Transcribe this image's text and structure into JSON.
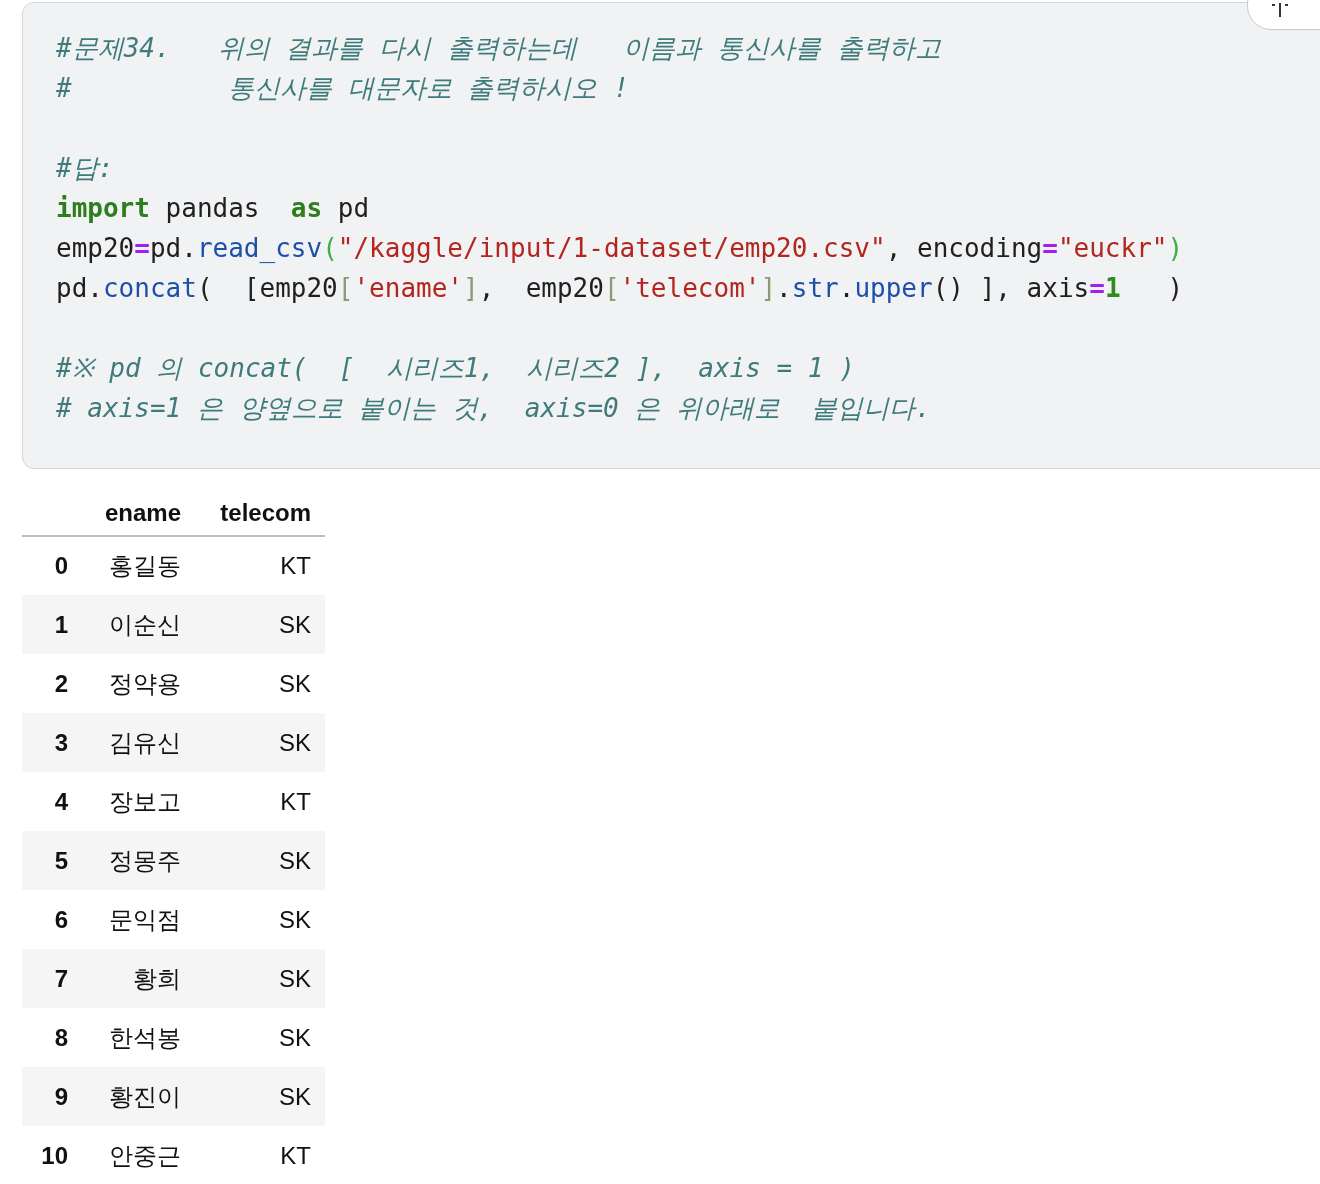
{
  "code_cell": {
    "lines": [
      {
        "kind": "code",
        "tokens": [
          {
            "kind": "comment",
            "text": "#문제34.   위의 결과를 다시 출력하는데   이름과 통신사를 출력하고"
          }
        ]
      },
      {
        "kind": "code",
        "tokens": [
          {
            "kind": "comment",
            "text": "#          통신사를 대문자로 출력하시오 !"
          }
        ]
      },
      {
        "kind": "blank"
      },
      {
        "kind": "code",
        "tokens": [
          {
            "kind": "comment",
            "text": "#답:"
          }
        ]
      },
      {
        "kind": "code",
        "tokens": [
          {
            "kind": "keyword",
            "text": "import"
          },
          {
            "kind": "name",
            "text": " pandas  "
          },
          {
            "kind": "keyword",
            "text": "as"
          },
          {
            "kind": "name",
            "text": " pd"
          }
        ]
      },
      {
        "kind": "code",
        "tokens": [
          {
            "kind": "name",
            "text": "emp20"
          },
          {
            "kind": "operator",
            "text": "="
          },
          {
            "kind": "name",
            "text": "pd."
          },
          {
            "kind": "call",
            "text": "read_csv"
          },
          {
            "kind": "paren",
            "text": "("
          },
          {
            "kind": "string",
            "text": "\"/kaggle/input/1-dataset/emp20.csv\""
          },
          {
            "kind": "name",
            "text": ", encoding"
          },
          {
            "kind": "operator",
            "text": "="
          },
          {
            "kind": "string",
            "text": "\"euckr\""
          },
          {
            "kind": "paren",
            "text": ")"
          }
        ]
      },
      {
        "kind": "code",
        "tokens": [
          {
            "kind": "name",
            "text": "pd."
          },
          {
            "kind": "call",
            "text": "concat"
          },
          {
            "kind": "name",
            "text": "(  [emp20"
          },
          {
            "kind": "bracket",
            "text": "["
          },
          {
            "kind": "string",
            "text": "'ename'"
          },
          {
            "kind": "bracket",
            "text": "]"
          },
          {
            "kind": "name",
            "text": ",  emp20"
          },
          {
            "kind": "bracket",
            "text": "["
          },
          {
            "kind": "string",
            "text": "'telecom'"
          },
          {
            "kind": "bracket",
            "text": "]"
          },
          {
            "kind": "name",
            "text": "."
          },
          {
            "kind": "call",
            "text": "str"
          },
          {
            "kind": "name",
            "text": "."
          },
          {
            "kind": "call",
            "text": "upper"
          },
          {
            "kind": "name",
            "text": "() ], axis"
          },
          {
            "kind": "operator",
            "text": "="
          },
          {
            "kind": "number",
            "text": "1"
          },
          {
            "kind": "name",
            "text": "   )"
          }
        ]
      },
      {
        "kind": "blank"
      },
      {
        "kind": "code",
        "tokens": [
          {
            "kind": "comment",
            "text": "#※ pd 의 concat(  [  시리즈1,  시리즈2 ],  axis = 1 )"
          }
        ]
      },
      {
        "kind": "code",
        "tokens": [
          {
            "kind": "comment",
            "text": "# axis=1 은 양옆으로 붙이는 것,  axis=0 은 위아래로  붙입니다."
          }
        ]
      }
    ]
  },
  "output_table": {
    "columns": [
      "ename",
      "telecom"
    ],
    "rows": [
      {
        "index": "0",
        "cells": [
          "홍길동",
          "KT"
        ]
      },
      {
        "index": "1",
        "cells": [
          "이순신",
          "SK"
        ]
      },
      {
        "index": "2",
        "cells": [
          "정약용",
          "SK"
        ]
      },
      {
        "index": "3",
        "cells": [
          "김유신",
          "SK"
        ]
      },
      {
        "index": "4",
        "cells": [
          "장보고",
          "KT"
        ]
      },
      {
        "index": "5",
        "cells": [
          "정몽주",
          "SK"
        ]
      },
      {
        "index": "6",
        "cells": [
          "문익점",
          "SK"
        ]
      },
      {
        "index": "7",
        "cells": [
          "황희",
          "SK"
        ]
      },
      {
        "index": "8",
        "cells": [
          "한석봉",
          "SK"
        ]
      },
      {
        "index": "9",
        "cells": [
          "황진이",
          "SK"
        ]
      },
      {
        "index": "10",
        "cells": [
          "안중근",
          "KT"
        ]
      }
    ]
  }
}
